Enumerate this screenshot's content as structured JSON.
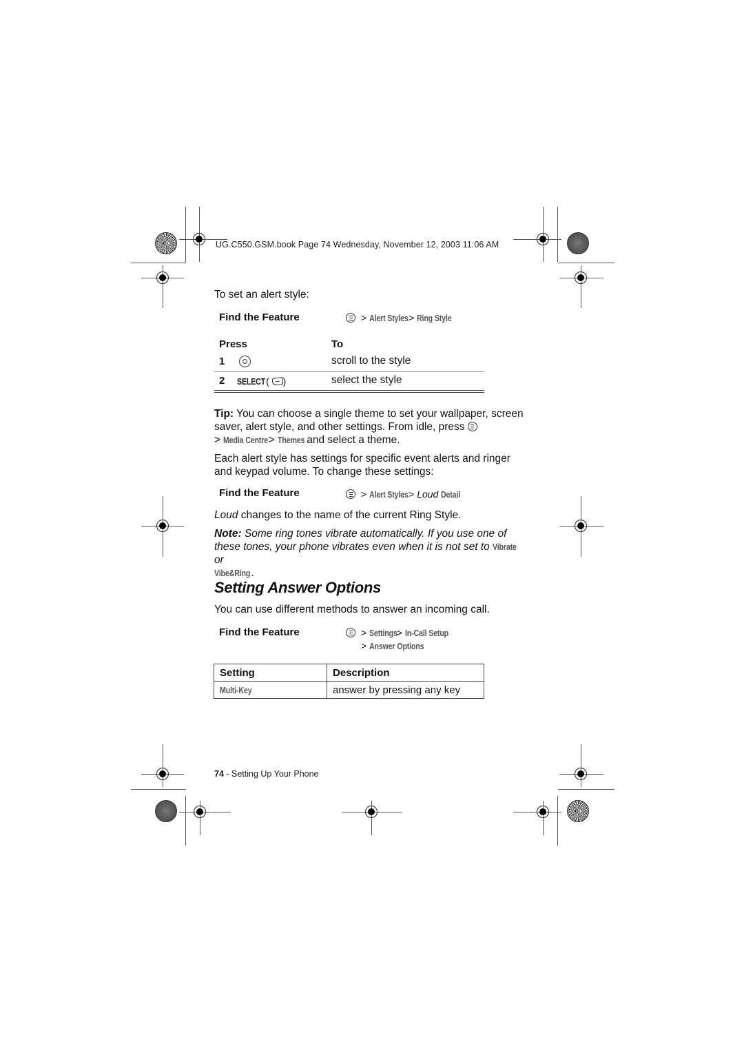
{
  "header": {
    "slug": "UG.C550.GSM.book  Page 74  Wednesday, November 12, 2003  11:06 AM"
  },
  "intro": "To set an alert style:",
  "find_feature_1": {
    "label": "Find the Feature",
    "icon": "menu-key-icon",
    "path": [
      "Alert Styles",
      "Ring Style"
    ]
  },
  "steps_table": {
    "headers": [
      "Press",
      "To"
    ],
    "rows": [
      {
        "num": "1",
        "key_icon": "nav-key-icon",
        "key_label": "",
        "action": "scroll to the style"
      },
      {
        "num": "2",
        "key_icon": "soft-key-icon",
        "key_label": "SELECT",
        "action": "select the style"
      }
    ]
  },
  "tip": {
    "label": "Tip:",
    "text_1": " You can choose a single theme to set your wallpaper, screen saver, alert style, and other settings. From idle, press ",
    "path": [
      "Media Centre",
      "Themes"
    ],
    "text_2": " and select a theme."
  },
  "paragraph_alert": "Each alert style has settings for specific event alerts and ringer and keypad volume. To change these settings:",
  "find_feature_2": {
    "label": "Find the Feature",
    "icon": "menu-key-icon",
    "path_1": "Alert Styles",
    "path_loud": "Loud",
    "path_detail": "Detail"
  },
  "loud_note": {
    "loud": "Loud",
    "text": " changes to the name of the current Ring Style."
  },
  "note": {
    "label": "Note:",
    "text": " Some ring tones vibrate automatically. If you use one of these tones, your phone vibrates even when it is not set to ",
    "term_1": "Vibrate",
    "or": " or ",
    "term_2": "Vibe&Ring",
    "end": "."
  },
  "section": {
    "title": "Setting Answer Options",
    "intro": "You can use different methods to answer an incoming call."
  },
  "find_feature_3": {
    "label": "Find the Feature",
    "icon": "menu-key-icon",
    "path": [
      "Settings",
      "In-Call Setup",
      "Answer Options"
    ]
  },
  "settings_table": {
    "headers": [
      "Setting",
      "Description"
    ],
    "rows": [
      {
        "setting": "Multi-Key",
        "description": "answer by pressing any key"
      }
    ]
  },
  "footer": {
    "page_number": "74",
    "separator": " - ",
    "section": "Setting Up Your Phone"
  },
  "separator_symbol": ">"
}
